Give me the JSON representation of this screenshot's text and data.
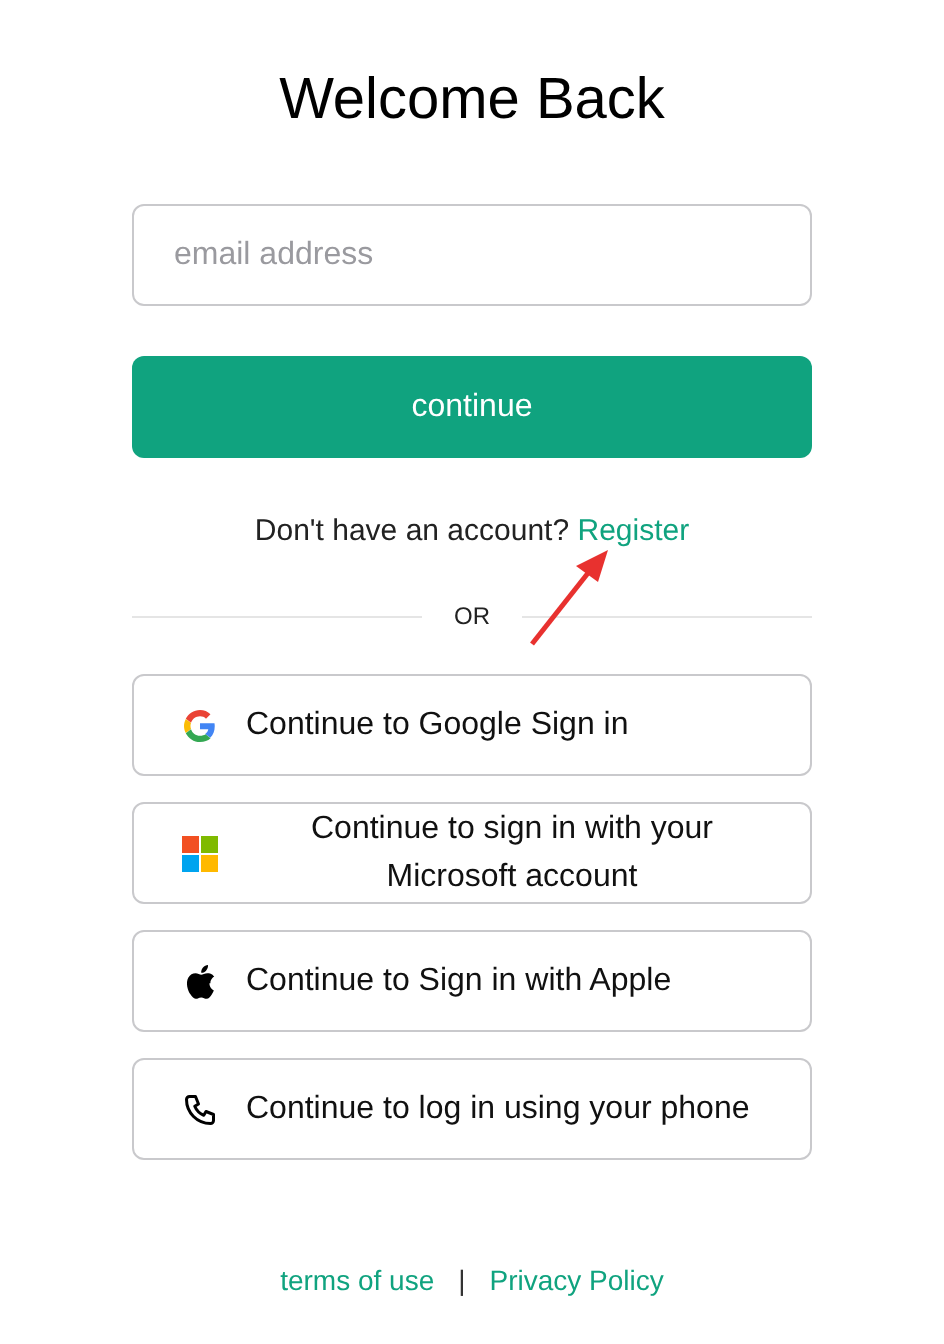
{
  "title": "Welcome Back",
  "email_field": {
    "placeholder": "email address"
  },
  "continue_button": "continue",
  "register_prompt": {
    "text": "Don't have an account?",
    "link": "Register"
  },
  "divider": "OR",
  "providers": [
    {
      "kind": "google",
      "label": "Continue to Google Sign in"
    },
    {
      "kind": "microsoft",
      "label": "Continue to sign in with your Microsoft account"
    },
    {
      "kind": "apple",
      "label": "Continue to Sign in with Apple"
    },
    {
      "kind": "phone",
      "label": "Continue to log in using your phone"
    }
  ],
  "footer": {
    "links": [
      "terms of use",
      "Privacy Policy"
    ],
    "separator": "|"
  }
}
